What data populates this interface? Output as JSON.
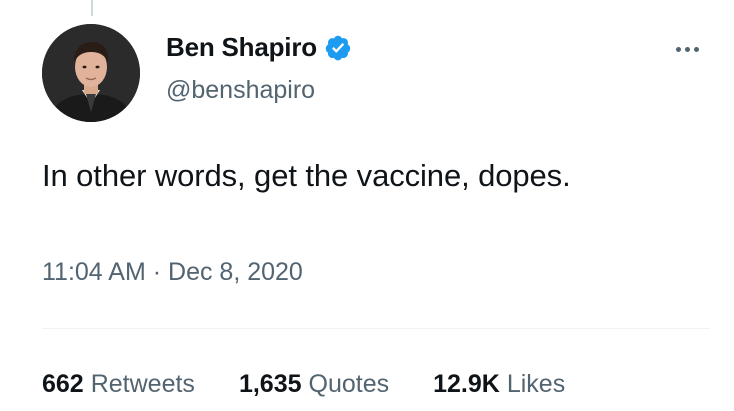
{
  "author": {
    "display_name": "Ben Shapiro",
    "handle": "@benshapiro",
    "verified": true
  },
  "tweet": {
    "text": "In other words, get the vaccine, dopes.",
    "time": "11:04 AM",
    "separator": "·",
    "date": "Dec 8, 2020"
  },
  "stats": {
    "retweets": {
      "count": "662",
      "label": "Retweets"
    },
    "quotes": {
      "count": "1,635",
      "label": "Quotes"
    },
    "likes": {
      "count": "12.9K",
      "label": "Likes"
    }
  },
  "colors": {
    "primary_text": "#0f1419",
    "secondary_text": "#536471",
    "verified_blue": "#1d9bf0",
    "divider": "#eff3f4"
  },
  "icons": {
    "verified": "verified-badge-icon",
    "more": "more-options-icon"
  }
}
